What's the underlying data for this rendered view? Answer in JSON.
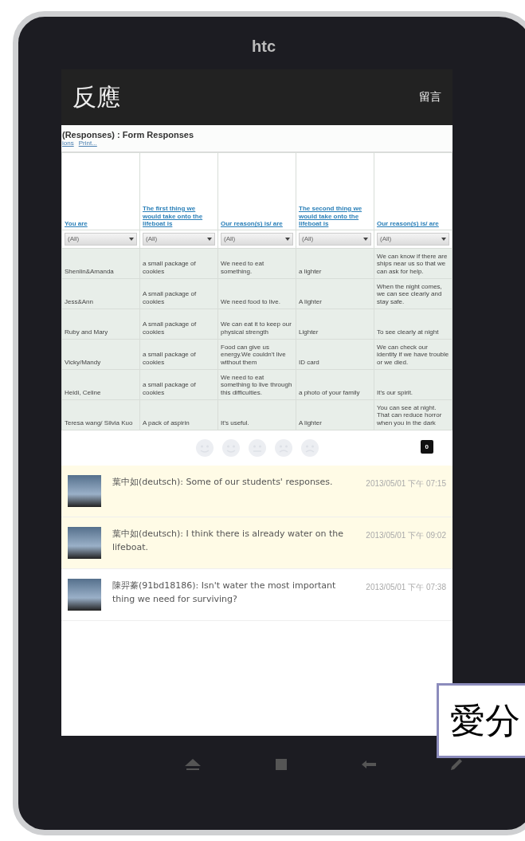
{
  "device": {
    "brand": "htc"
  },
  "app_bar": {
    "title": "反應",
    "action": "留言"
  },
  "sheet": {
    "title": "(Responses) : Form Responses",
    "links": [
      "ions",
      "Print..."
    ],
    "columns": [
      {
        "header": "You are",
        "filter": "(All)"
      },
      {
        "header": "The first thing we would take onto the lifeboat is",
        "filter": "(All)"
      },
      {
        "header": "Our reason(s) is/ are",
        "filter": "(All)"
      },
      {
        "header": "The second thing we would take onto the lifeboat is",
        "filter": "(All)"
      },
      {
        "header": "Our reason(s) is/ are",
        "filter": "(All)"
      }
    ],
    "rows": [
      [
        "Shenlin&Amanda",
        "a small package of cookies",
        "We need to eat something.",
        "a lighter",
        "We can know if there are ships near us so that we can ask for help."
      ],
      [
        "Jess&Ann",
        "A small package of cookies",
        "We need food to live.",
        "A lighter",
        "When the night comes, we can see clearly and stay safe."
      ],
      [
        "Ruby and Mary",
        "A small package of cookies",
        "We can eat it to keep our physical strength",
        "Lighter",
        "To see clearly at night"
      ],
      [
        "Vicky/Mandy",
        "a small package of cookies",
        "Food can give us energy.We couldn't live without them",
        "ID card",
        "We can check our identity if we have trouble or we died."
      ],
      [
        "Heidi, Celine",
        "a small package of cookies",
        "We need to eat something to live through this difficulties.",
        "a photo of your family",
        "It's our spirit."
      ],
      [
        "Teresa wang/ Silvia Kuo",
        "A pack of aspirin",
        "It's useful.",
        "A lighter",
        "You can see at night. That can reduce horror when you in the dark"
      ]
    ]
  },
  "rating": {
    "count": "0"
  },
  "comments": [
    {
      "text": "葉中如(deutsch): Some of our students' responses.",
      "time": "2013/05/01 下午 07:15",
      "highlighted": true
    },
    {
      "text": "葉中如(deutsch): I think there is already water on the lifeboat.",
      "time": "2013/05/01 下午 09:02",
      "highlighted": true
    },
    {
      "text": "陳羿蓁(91bd18186): Isn't water the most important thing we need for surviving?",
      "time": "2013/05/01 下午 07:38",
      "highlighted": false
    }
  ],
  "caption": "愛分"
}
